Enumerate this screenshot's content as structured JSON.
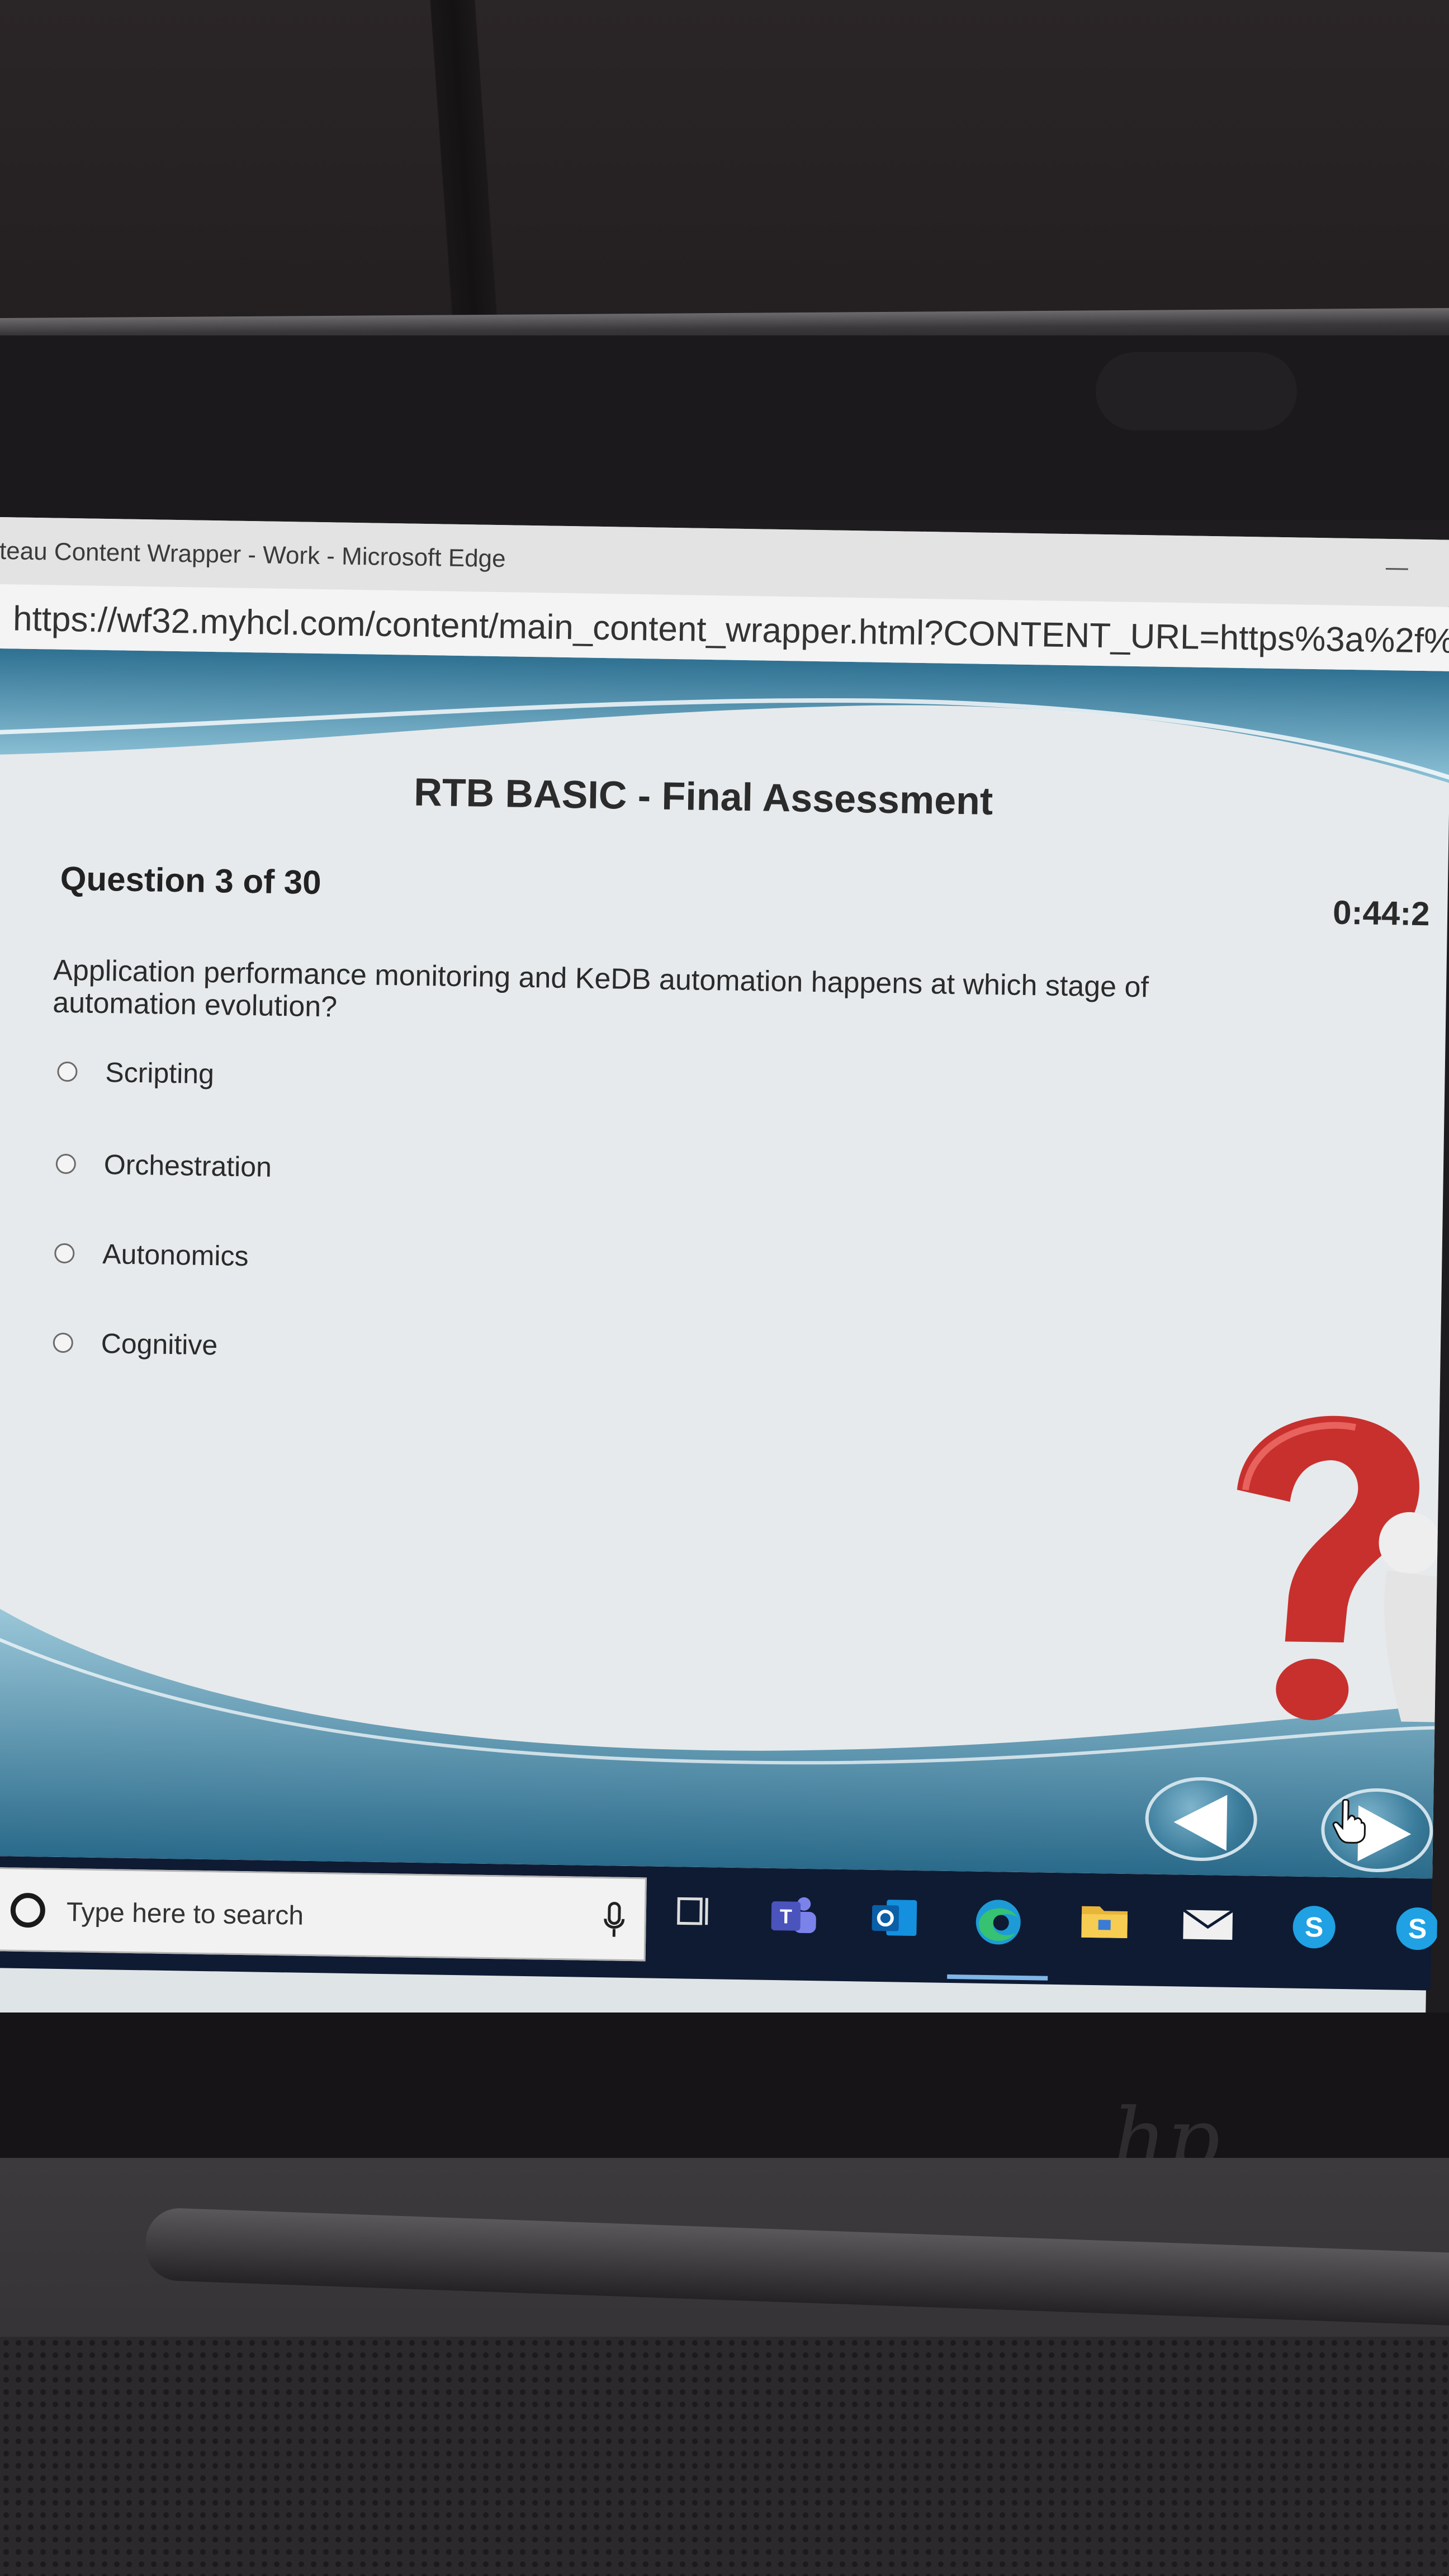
{
  "browser": {
    "window_title": "teau Content Wrapper - Work - Microsoft Edge",
    "url": "https://wf32.myhcl.com/content/main_content_wrapper.html?CONTENT_URL=https%3a%2f%2f"
  },
  "assessment": {
    "title": "RTB BASIC - Final Assessment",
    "question_counter": "Question 3 of 30",
    "timer": "0:44:2",
    "question": "Application performance monitoring and KeDB automation happens at which stage of automation evolution?",
    "options": [
      "Scripting",
      "Orchestration",
      "Autonomics",
      "Cognitive"
    ],
    "selected_option": null
  },
  "navigation": {
    "previous_icon": "left-arrow-icon",
    "next_icon": "right-arrow-icon"
  },
  "taskbar": {
    "search_placeholder": "Type here to search",
    "icons": [
      "microphone-icon",
      "task-view-icon",
      "teams-icon",
      "outlook-icon",
      "edge-icon",
      "file-explorer-icon",
      "mail-icon",
      "skype-icon"
    ],
    "active_app": "edge-icon"
  },
  "hardware": {
    "brand_logo": "hp"
  },
  "colors": {
    "taskbar": "#0f1b33",
    "content_wave": "#3b7d9c",
    "question_mark": "#c8302d"
  }
}
